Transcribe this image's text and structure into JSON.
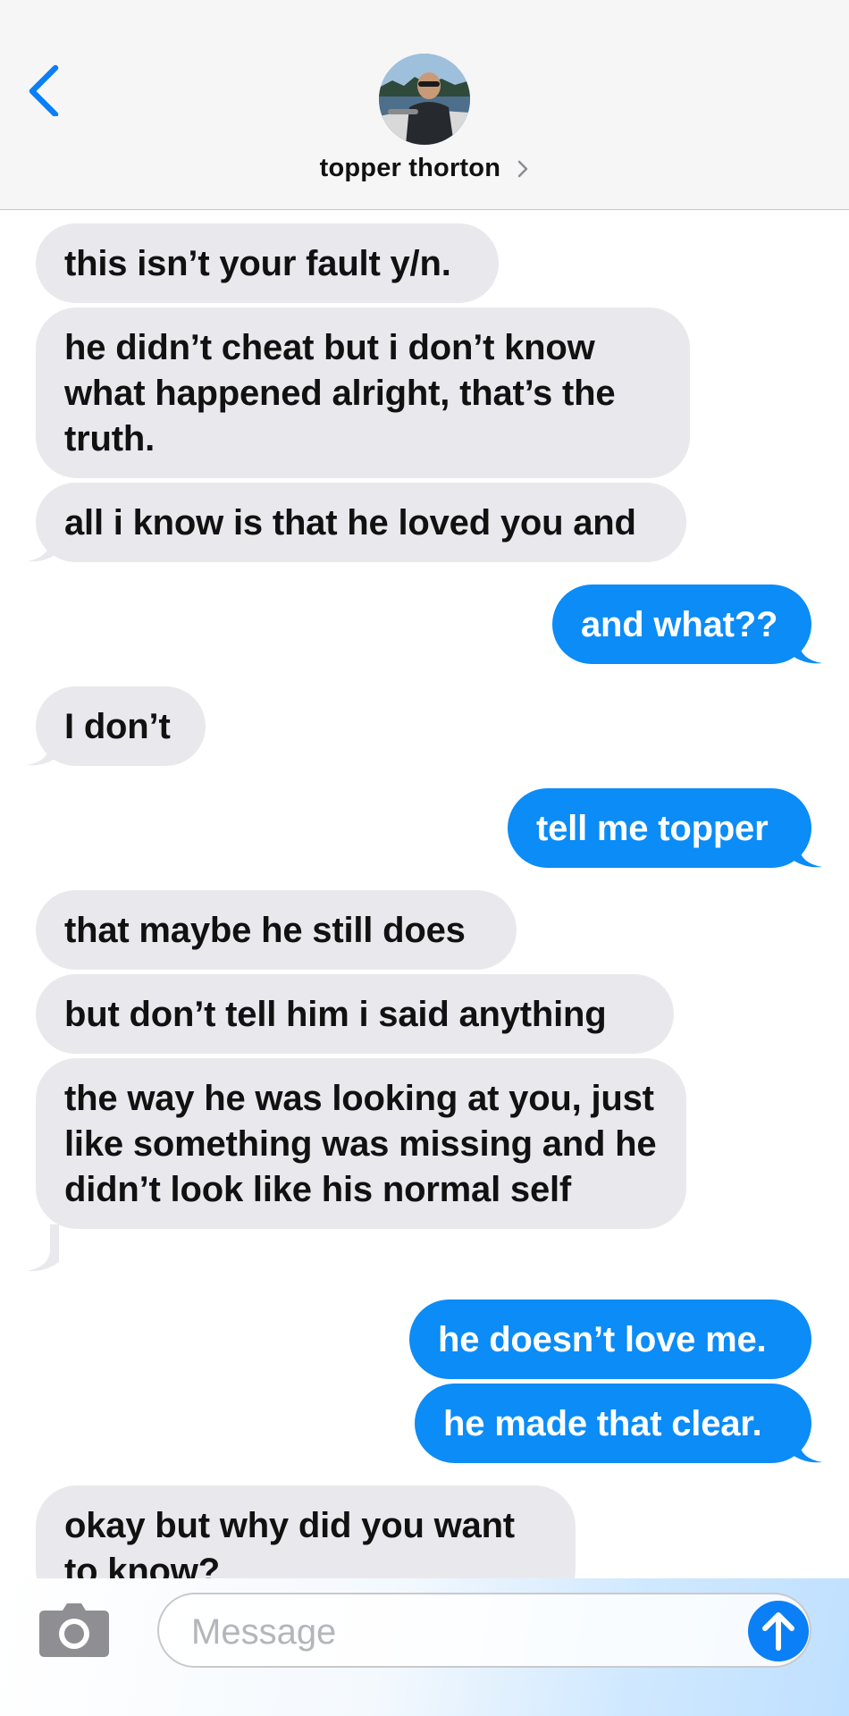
{
  "header": {
    "contact_name": "topper thorton"
  },
  "messages": [
    {
      "dir": "in",
      "text": "this isn’t your fault y/n."
    },
    {
      "dir": "in",
      "text": "he didn’t cheat but i don’t know what happened alright, that’s the truth."
    },
    {
      "dir": "in",
      "text": "all i know is that he loved you and"
    },
    {
      "dir": "out",
      "text": "and what??"
    },
    {
      "dir": "in",
      "text": "I don’t"
    },
    {
      "dir": "out",
      "text": "tell me topper"
    },
    {
      "dir": "in",
      "text": "that maybe he still does"
    },
    {
      "dir": "in",
      "text": "but don’t tell him i said anything"
    },
    {
      "dir": "in",
      "text": "the way he was looking at you, just like something was missing and he didn’t look like his normal self"
    },
    {
      "dir": "out",
      "text": "he doesn’t love me."
    },
    {
      "dir": "out",
      "text": "he made that clear."
    },
    {
      "dir": "in",
      "text": "okay but why did you want to know?"
    }
  ],
  "composer": {
    "placeholder": "Message"
  },
  "icons": {
    "back": "chevron-left-icon",
    "camera": "camera-icon",
    "send": "send-arrow-up-icon",
    "contact_chevron": "chevron-right-icon"
  },
  "colors": {
    "accent": "#0b8cf7",
    "incoming_bubble": "#e9e9ed",
    "header_bg": "#f6f6f6"
  }
}
